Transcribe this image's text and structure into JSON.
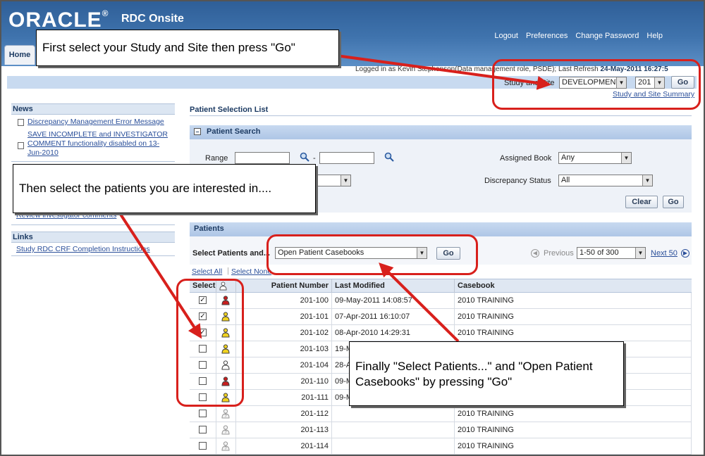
{
  "header": {
    "logo": "ORACLE",
    "product": "RDC Onsite",
    "global_links": [
      "Logout",
      "Preferences",
      "Change Password",
      "Help"
    ],
    "tab_home": "Home"
  },
  "login": {
    "prefix": "Logged in as Kevin Stephenson",
    "role": "(Data management role, PSDE); Last Refresh",
    "refresh": "24-May-2011 16:27:5"
  },
  "study_site": {
    "label": "Study and Site",
    "study_value": "DEVELOPMENT",
    "site_value": "201",
    "go_label": "Go",
    "summary_link": "Study and Site Summary"
  },
  "news": {
    "title": "News",
    "items": [
      "Discrepancy Management Error Message",
      "SAVE INCOMPLETE and INVESTIGATOR COMMENT functionality disabled on 13-Jun-2010"
    ]
  },
  "sidebar_extra": {
    "partial_link": "Review investigator comments"
  },
  "links": {
    "title": "Links",
    "items": [
      "Study RDC CRF Completion Instructions"
    ]
  },
  "main": {
    "title": "Patient Selection List",
    "search": {
      "title": "Patient Search",
      "range_label": "Range",
      "dash": "-",
      "assigned_book_label": "Assigned Book",
      "assigned_book_value": "Any",
      "disc_status_label": "Discrepancy Status",
      "disc_status_value": "All",
      "clear_label": "Clear",
      "go_label": "Go"
    },
    "patients": {
      "title": "Patients",
      "select_label": "Select Patients and...",
      "action_value": "Open Patient Casebooks",
      "go_label": "Go",
      "previous_label": "Previous",
      "range_value": "1-50 of 300",
      "next_label": "Next 50",
      "select_all": "Select All",
      "select_none": "Select None"
    },
    "columns": [
      "Select",
      "Patient Number",
      "Last Modified",
      "Casebook"
    ],
    "rows": [
      {
        "checked": true,
        "status": "red",
        "number": "201-100",
        "modified": "09-May-2011 14:08:57",
        "casebook": "2010 TRAINING"
      },
      {
        "checked": true,
        "status": "yellow",
        "number": "201-101",
        "modified": "07-Apr-2011 16:10:07",
        "casebook": "2010 TRAINING"
      },
      {
        "checked": true,
        "status": "yellow",
        "number": "201-102",
        "modified": "08-Apr-2010 14:29:31",
        "casebook": "2010 TRAINING"
      },
      {
        "checked": false,
        "status": "yellow",
        "number": "201-103",
        "modified": "19-M",
        "casebook": ""
      },
      {
        "checked": false,
        "status": "white",
        "number": "201-104",
        "modified": "28-A",
        "casebook": ""
      },
      {
        "checked": false,
        "status": "red",
        "number": "201-110",
        "modified": "09-M",
        "casebook": ""
      },
      {
        "checked": false,
        "status": "yellow",
        "number": "201-111",
        "modified": "09-M",
        "casebook": ""
      },
      {
        "checked": false,
        "status": "unknown",
        "number": "201-112",
        "modified": "",
        "casebook": "2010 TRAINING"
      },
      {
        "checked": false,
        "status": "unknown",
        "number": "201-113",
        "modified": "",
        "casebook": "2010 TRAINING"
      },
      {
        "checked": false,
        "status": "unknown",
        "number": "201-114",
        "modified": "",
        "casebook": "2010 TRAINING"
      }
    ]
  },
  "annotations": {
    "callout1": "First select your Study and Site then press \"Go\"",
    "callout2": "Then select the patients you are interested in....",
    "callout3": "Finally \"Select Patients...\" and \"Open Patient Casebooks\" by pressing \"Go\""
  },
  "colors": {
    "header_blue": "#3f73ad",
    "annotation_red": "#d8201c",
    "status_red": "#c81e1e",
    "status_yellow": "#f0d21e"
  }
}
